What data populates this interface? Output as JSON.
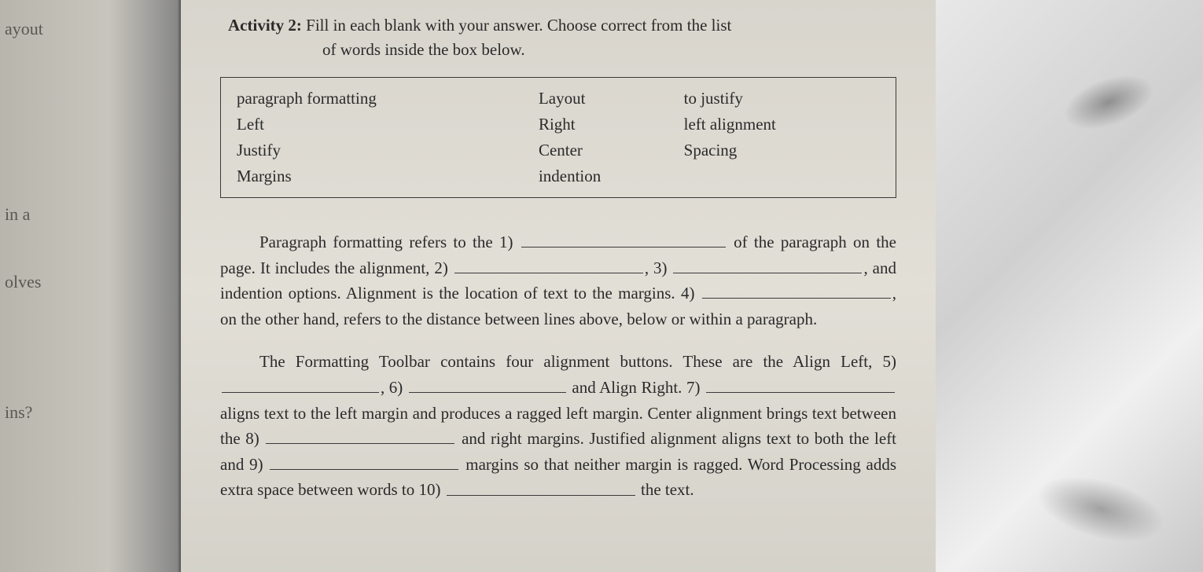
{
  "left_margin": {
    "w1": "ayout",
    "w2": "in a",
    "w3": "olves",
    "w4": "ins?"
  },
  "activity": {
    "label": "Activity 2:",
    "instruction_line1": "Fill in each blank with your answer. Choose correct from the list",
    "instruction_line2": "of words inside the box below."
  },
  "word_box": {
    "r1c1": "paragraph formatting",
    "r1c2": "Layout",
    "r1c3": "to justify",
    "r2c1": "Left",
    "r2c2": "Right",
    "r2c3": "left alignment",
    "r3c1": "Justify",
    "r3c2": "Center",
    "r3c3": "Spacing",
    "r4c1": "Margins",
    "r4c2": "indention",
    "r4c3": ""
  },
  "p1": {
    "t1": "Paragraph formatting refers to the 1)",
    "t2": "of the paragraph on the page. It includes the alignment, 2)",
    "t2b": ",",
    "t3": "3)",
    "t3b": ", and indention options. Alignment is the location of text to the margins. 4)",
    "t4": ", on the other hand, refers to the distance between lines above, below or within a paragraph."
  },
  "p2": {
    "t1": "The Formatting Toolbar contains four alignment buttons. These are the Align Left, 5)",
    "t2": ", 6)",
    "t3": "and Align Right. 7)",
    "t4": "aligns text to the left margin and produces a ragged left margin. Center alignment brings text between the 8)",
    "t5": "and right margins. Justified alignment aligns text to both the left and 9)",
    "t6": "margins so that neither margin is ragged. Word Processing adds extra space between words to 10)",
    "t7": "the text."
  }
}
